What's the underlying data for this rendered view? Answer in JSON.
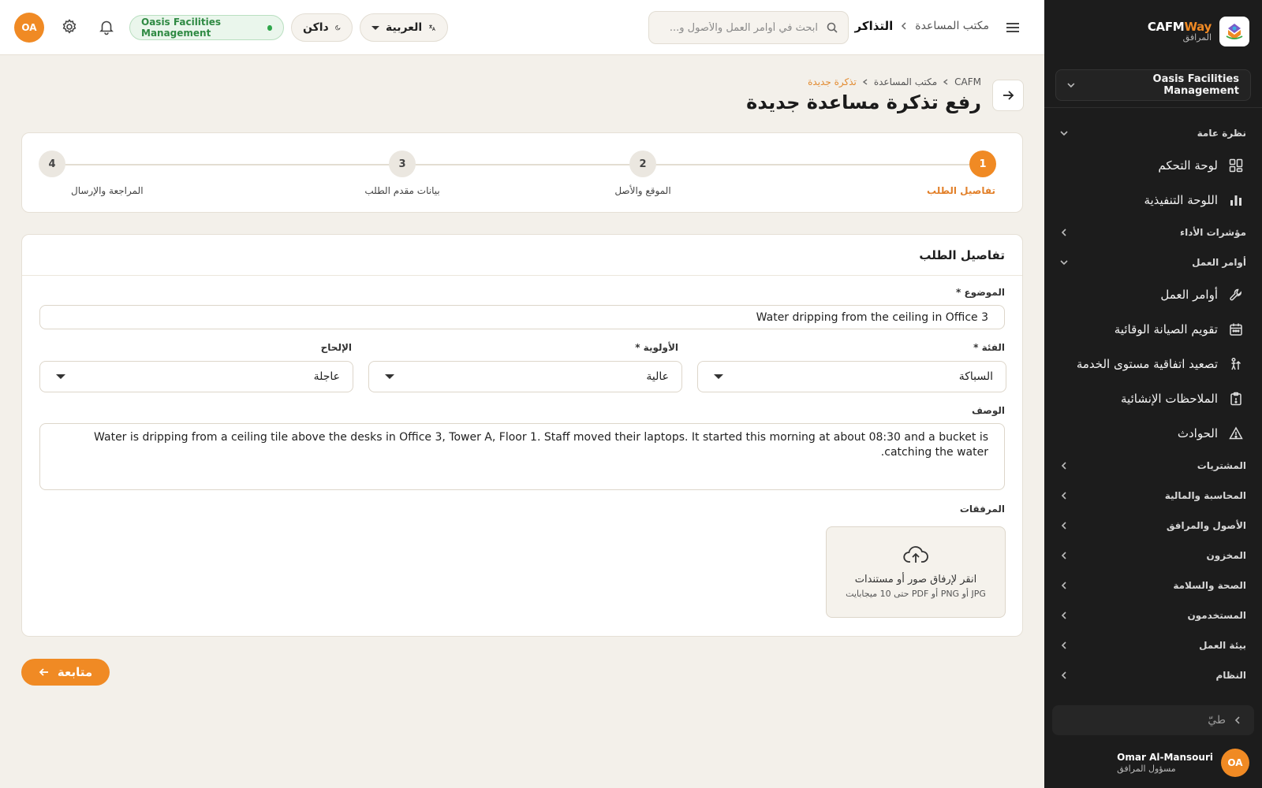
{
  "colors": {
    "accent": "#f08a24",
    "sidebar_bg": "#1c1c1c",
    "page_bg": "#f3f0ea",
    "status_green": "#2fa64b"
  },
  "sidebar": {
    "brand_name_a": "CAFM",
    "brand_name_b": "Way",
    "brand_sub": "المرافق",
    "org_select": "Oasis Facilities Management",
    "groups": {
      "overview": "نظرة عامة",
      "kpis": "مؤشرات الأداء",
      "work_orders": "أوامر العمل",
      "purchasing": "المشتريات",
      "accounting": "المحاسبة والمالية",
      "assets": "الأصول والمرافق",
      "inventory": "المخزون",
      "hse": "الصحة والسلامة",
      "users": "المستخدمون",
      "environment": "بيئة العمل",
      "system": "النظام"
    },
    "items": {
      "dashboard": "لوحة التحكم",
      "executive": "اللوحة التنفيذية",
      "work_orders": "أوامر العمل",
      "pm_calendar": "تقويم الصيانة الوقائية",
      "sla_escalation": "تصعيد اتفاقية مستوى الخدمة",
      "construction_notes": "الملاحظات الإنشائية",
      "incidents": "الحوادث"
    },
    "search_placeholder": "طيّ",
    "user": {
      "initials": "OA",
      "name": "Omar Al-Mansouri",
      "role": "مسؤول المرافق"
    }
  },
  "topbar": {
    "crumb_parent": "مكتب المساعدة",
    "crumb_current": "التذاكر",
    "search_placeholder": "ابحث في أوامر العمل والأصول و...",
    "language": "العربية",
    "theme": "داكن",
    "org_badge": "Oasis Facilities Management",
    "avatar_initials": "OA"
  },
  "page": {
    "breadcrumb": [
      "CAFM",
      "مكتب المساعدة",
      "تذكرة جديدة"
    ],
    "title": "رفع تذكرة مساعدة جديدة"
  },
  "stepper": {
    "steps": [
      {
        "num": "1",
        "label": "تفاصيل الطلب"
      },
      {
        "num": "2",
        "label": "الموقع والأصل"
      },
      {
        "num": "3",
        "label": "بيانات مقدم الطلب"
      },
      {
        "num": "4",
        "label": "المراجعة والإرسال"
      }
    ],
    "active_step": 1
  },
  "form": {
    "section_title": "تفاصيل الطلب",
    "subject_label": "الموضوع *",
    "subject_value": "Water dripping from the ceiling in Office 3",
    "category_label": "الفئة *",
    "category_value": "السباكة",
    "priority_label": "الأولوية *",
    "priority_value": "عالية",
    "urgency_label": "الإلحاح",
    "urgency_value": "عاجلة",
    "description_label": "الوصف",
    "description_value": "Water is dripping from a ceiling tile above the desks in Office 3, Tower A, Floor 1. Staff moved their laptops. It started this morning at about 08:30 and a bucket is catching the water.",
    "attachments_label": "المرفقات",
    "upload_main": "انقر لإرفاق صور أو مستندات",
    "upload_hint": "JPG أو PNG أو PDF حتى 10 ميجابايت"
  },
  "actions": {
    "continue": "متابعة"
  }
}
